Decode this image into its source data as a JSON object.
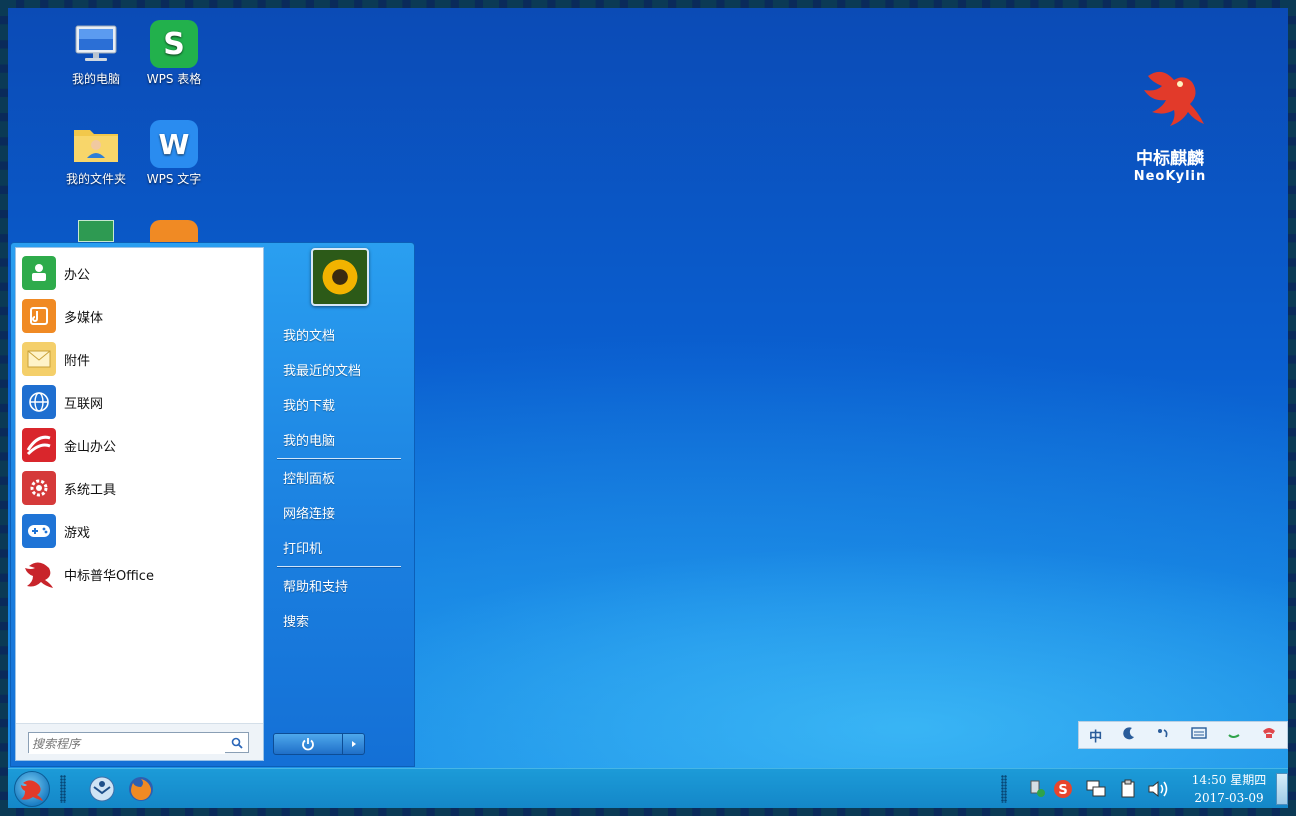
{
  "desktop": {
    "icons": [
      {
        "label": "我的电脑",
        "icon": "computer-icon"
      },
      {
        "label": "WPS 表格",
        "icon": "wps-spreadsheet-icon",
        "glyph": "S"
      },
      {
        "label": "我的文件夹",
        "icon": "user-folder-icon"
      },
      {
        "label": "WPS 文字",
        "icon": "wps-writer-icon",
        "glyph": "W"
      }
    ],
    "logo": {
      "cn": "中标麒麟",
      "en": "NeoKylin"
    }
  },
  "start_menu": {
    "programs": [
      {
        "label": "办公",
        "icon": "office-icon",
        "color": "#2eab4b"
      },
      {
        "label": "多媒体",
        "icon": "multimedia-icon",
        "color": "#f08a24"
      },
      {
        "label": "附件",
        "icon": "accessories-icon",
        "color": "#f4cf6a"
      },
      {
        "label": "互联网",
        "icon": "internet-icon",
        "color": "#1f6fd0"
      },
      {
        "label": "金山办公",
        "icon": "kingsoft-office-icon",
        "color": "#d9262c"
      },
      {
        "label": "系统工具",
        "icon": "system-tools-icon",
        "color": "#d53a3a"
      },
      {
        "label": "游戏",
        "icon": "games-icon",
        "color": "#1f74d6"
      },
      {
        "label": "中标普华Office",
        "icon": "cs2c-office-icon",
        "color": "#c8242b"
      }
    ],
    "search": {
      "placeholder": "搜索程序"
    },
    "links": [
      {
        "label": "我的文档"
      },
      {
        "label": "我最近的文档"
      },
      {
        "label": "我的下载"
      },
      {
        "label": "我的电脑"
      },
      {
        "label": "控制面板"
      },
      {
        "label": "网络连接"
      },
      {
        "label": "打印机"
      },
      {
        "label": "帮助和支持"
      },
      {
        "label": "搜索"
      }
    ]
  },
  "ime_bar": {
    "mode": "中",
    "items": [
      "moon-icon",
      "punctuation-icon",
      "keyboard-icon",
      "skin-icon",
      "settings-icon"
    ]
  },
  "taskbar": {
    "clock": {
      "time": "14:50 星期四",
      "date": "2017-03-09"
    },
    "apps": [
      "email-client-icon",
      "firefox-icon"
    ],
    "tray": [
      "removable-device-icon",
      "sogou-input-icon",
      "network-icon",
      "clipboard-icon",
      "volume-icon"
    ]
  },
  "colors": {
    "taskbar": "#1c9bd8",
    "menu_right": "#2a9ff0",
    "accent": "#0a5fd0"
  }
}
